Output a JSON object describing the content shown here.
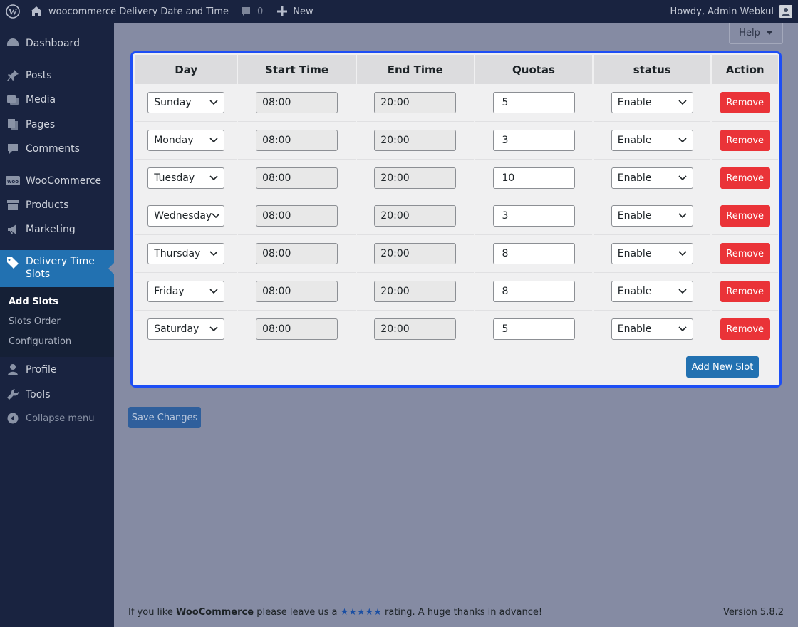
{
  "adminbar": {
    "site_name": "woocommerce Delivery Date and Time",
    "comments_count": "0",
    "new_label": "New",
    "howdy": "Howdy, Admin Webkul"
  },
  "sidebar": {
    "items": [
      {
        "label": "Dashboard",
        "icon": "dashboard-icon"
      },
      {
        "label": "Posts",
        "icon": "pin-icon"
      },
      {
        "label": "Media",
        "icon": "media-icon"
      },
      {
        "label": "Pages",
        "icon": "pages-icon"
      },
      {
        "label": "Comments",
        "icon": "comment-icon"
      },
      {
        "label": "WooCommerce",
        "icon": "woo-icon"
      },
      {
        "label": "Products",
        "icon": "archive-icon"
      },
      {
        "label": "Marketing",
        "icon": "megaphone-icon"
      },
      {
        "label": "Delivery Time Slots",
        "icon": "tag-icon"
      },
      {
        "label": "Profile",
        "icon": "user-icon"
      },
      {
        "label": "Tools",
        "icon": "wrench-icon"
      }
    ],
    "submenu": [
      "Add Slots",
      "Slots Order",
      "Configuration"
    ],
    "collapse_label": "Collapse menu"
  },
  "help_label": "Help",
  "table": {
    "headers": [
      "Day",
      "Start Time",
      "End Time",
      "Quotas",
      "status",
      "Action"
    ],
    "rows": [
      {
        "day": "Sunday",
        "start": "08:00",
        "end": "20:00",
        "quota": "5",
        "status": "Enable",
        "action": "Remove"
      },
      {
        "day": "Monday",
        "start": "08:00",
        "end": "20:00",
        "quota": "3",
        "status": "Enable",
        "action": "Remove"
      },
      {
        "day": "Tuesday",
        "start": "08:00",
        "end": "20:00",
        "quota": "10",
        "status": "Enable",
        "action": "Remove"
      },
      {
        "day": "Wednesday",
        "start": "08:00",
        "end": "20:00",
        "quota": "3",
        "status": "Enable",
        "action": "Remove"
      },
      {
        "day": "Thursday",
        "start": "08:00",
        "end": "20:00",
        "quota": "8",
        "status": "Enable",
        "action": "Remove"
      },
      {
        "day": "Friday",
        "start": "08:00",
        "end": "20:00",
        "quota": "8",
        "status": "Enable",
        "action": "Remove"
      },
      {
        "day": "Saturday",
        "start": "08:00",
        "end": "20:00",
        "quota": "5",
        "status": "Enable",
        "action": "Remove"
      }
    ]
  },
  "add_slot_label": "Add New Slot",
  "save_label": "Save Changes",
  "footer": {
    "prefix": "If you like",
    "brand": "WooCommerce",
    "middle": "please leave us a",
    "stars": "★★★★★",
    "suffix": "rating. A huge thanks in advance!",
    "version": "Version 5.8.2"
  },
  "colors": {
    "accent": "#2271b1",
    "remove": "#ea3338",
    "panel_border": "#1d4ef5",
    "sidebar": "#192340"
  }
}
